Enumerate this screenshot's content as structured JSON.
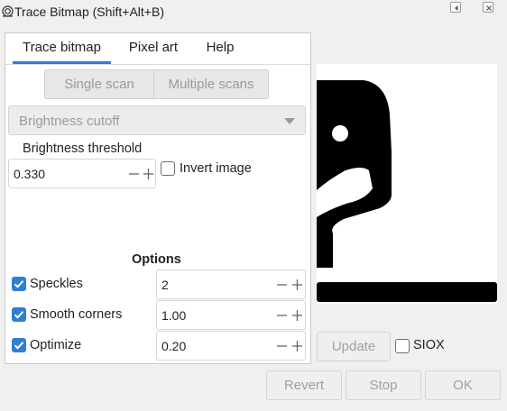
{
  "window": {
    "title": "Trace Bitmap (Shift+Alt+B)"
  },
  "tabs": [
    {
      "label": "Trace bitmap",
      "active": true
    },
    {
      "label": "Pixel art",
      "active": false
    },
    {
      "label": "Help",
      "active": false
    }
  ],
  "scan_mode": {
    "options": [
      "Single scan",
      "Multiple scans"
    ],
    "selected": "Single scan"
  },
  "algorithm": {
    "selected": "Brightness cutoff"
  },
  "threshold": {
    "label": "Brightness threshold",
    "value": "0.330"
  },
  "invert": {
    "label": "Invert image",
    "checked": false
  },
  "options": {
    "heading": "Options",
    "items": [
      {
        "label": "Speckles",
        "checked": true,
        "value": "2"
      },
      {
        "label": "Smooth corners",
        "checked": true,
        "value": "1.00"
      },
      {
        "label": "Optimize",
        "checked": true,
        "value": "0.20"
      }
    ]
  },
  "preview": {
    "update_label": "Update",
    "siox_label": "SIOX",
    "siox_checked": false,
    "icon": "chess-knight-icon"
  },
  "footer": {
    "revert_label": "Revert",
    "stop_label": "Stop",
    "ok_label": "OK"
  },
  "colors": {
    "accent": "#2f7fd4",
    "disabled_text": "#9a9a9a"
  }
}
